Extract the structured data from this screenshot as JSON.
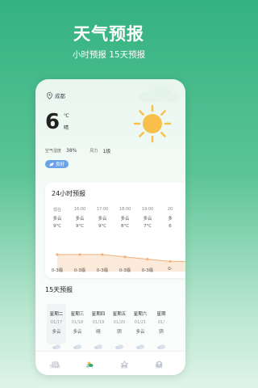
{
  "promo": {
    "title": "天气预报",
    "subtitle": "小时预报  15天预报"
  },
  "current": {
    "city": "成都",
    "temperature": "6",
    "unit": "℃",
    "condition": "晴",
    "humidity_label": "空气湿度",
    "humidity_value": "38%",
    "wind_label": "风力",
    "wind_value": "1级",
    "aqi": "良好"
  },
  "hourly": {
    "title": "24小时预报",
    "items": [
      {
        "time": "现在",
        "cond": "多云",
        "temp": "9°C",
        "wind": "0-3级",
        "temp_value": 9
      },
      {
        "time": "16:00",
        "cond": "多云",
        "temp": "9°C",
        "wind": "0-3级",
        "temp_value": 9
      },
      {
        "time": "17:00",
        "cond": "多云",
        "temp": "9°C",
        "wind": "0-3级",
        "temp_value": 9
      },
      {
        "time": "18:00",
        "cond": "多云",
        "temp": "8°C",
        "wind": "0-3级",
        "temp_value": 8
      },
      {
        "time": "19:00",
        "cond": "多云",
        "temp": "7°C",
        "wind": "0-3级",
        "temp_value": 7
      },
      {
        "time": "20",
        "cond": "多",
        "temp": "6",
        "wind": "0-",
        "temp_value": 6
      }
    ]
  },
  "daily": {
    "title": "15天预报",
    "items": [
      {
        "name": "星期二",
        "date": "01/17",
        "cond": "多云",
        "active": true
      },
      {
        "name": "星期三",
        "date": "01/18",
        "cond": "多云",
        "active": false
      },
      {
        "name": "星期四",
        "date": "01/19",
        "cond": "晴",
        "active": false
      },
      {
        "name": "星期五",
        "date": "01/20",
        "cond": "阴",
        "active": false
      },
      {
        "name": "星期六",
        "date": "01/21",
        "cond": "多云",
        "active": false
      },
      {
        "name": "星期",
        "date": "01/",
        "cond": "阴",
        "active": false
      }
    ]
  },
  "tabs": [
    {
      "label": "万年历",
      "icon": "calendar-icon",
      "active": false
    },
    {
      "label": "天气",
      "icon": "weather-icon",
      "active": true
    },
    {
      "label": "星座",
      "icon": "star-icon",
      "active": false
    },
    {
      "label": "我的",
      "icon": "user-icon",
      "active": false
    }
  ],
  "colors": {
    "accent": "#3aa877",
    "chart_line": "#f0b27a",
    "sun": "#f8c04a",
    "aqi_badge": "#6aa3e8"
  }
}
